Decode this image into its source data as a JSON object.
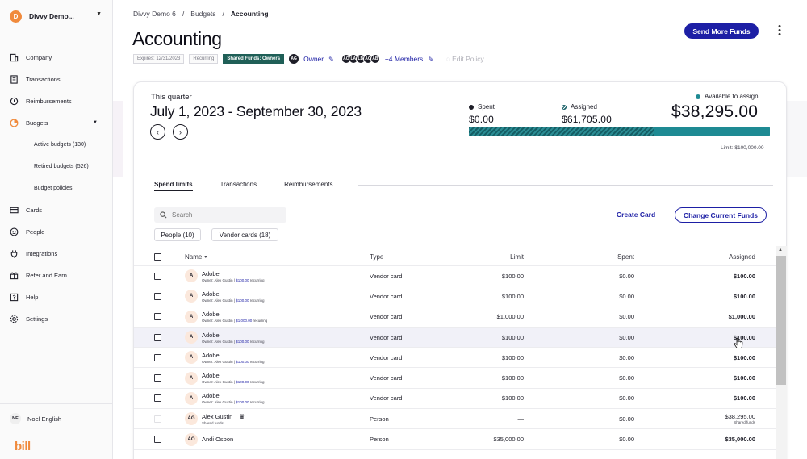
{
  "org": {
    "initial": "D",
    "name": "Divvy Demo..."
  },
  "sidebar": {
    "items": [
      {
        "label": "Company",
        "icon": "building-icon"
      },
      {
        "label": "Transactions",
        "icon": "receipt-icon"
      },
      {
        "label": "Reimbursements",
        "icon": "reimbursement-icon"
      },
      {
        "label": "Budgets",
        "icon": "budget-icon"
      }
    ],
    "budget_sub": [
      "Active budgets (130)",
      "Retired budgets (526)",
      "Budget policies"
    ],
    "items_after": [
      {
        "label": "Cards",
        "icon": "card-icon"
      },
      {
        "label": "People",
        "icon": "people-icon"
      },
      {
        "label": "Integrations",
        "icon": "integrations-icon"
      },
      {
        "label": "Refer and Earn",
        "icon": "gift-icon"
      },
      {
        "label": "Help",
        "icon": "help-icon"
      },
      {
        "label": "Settings",
        "icon": "gear-icon"
      }
    ],
    "user": {
      "initials": "NE",
      "name": "Noel English"
    },
    "logo": "bill"
  },
  "breadcrumb": {
    "first": "Divvy Demo 6",
    "second": "Budgets",
    "current": "Accounting",
    "sep": "/"
  },
  "page": {
    "title": "Accounting",
    "send_funds": "Send More Funds"
  },
  "meta": {
    "expires": "Expires: 12/31/2023",
    "recurring": "Recurring",
    "shared": "Shared Funds: Owners",
    "owner_initials": "AG",
    "owner_label": "Owner",
    "member_initials": [
      "AO",
      "LA",
      "LB",
      "AC",
      "AB"
    ],
    "members_label": "+4 Members",
    "edit_policy": "Edit Policy"
  },
  "summary": {
    "quarter_label": "This quarter",
    "range": "July 1, 2023 - September 30, 2023",
    "spent_label": "Spent",
    "spent_value": "$0.00",
    "assigned_label": "Assigned",
    "assigned_value": "$61,705.00",
    "available_label": "Available to assign",
    "available_value": "$38,295.00",
    "limit": "Limit: $100,000.00",
    "assigned_fraction": 0.617,
    "colors": {
      "spent": "#1d1d27",
      "available": "#1e8a93"
    }
  },
  "tabs": [
    "Spend limits",
    "Transactions",
    "Reimbursements"
  ],
  "toolbar": {
    "search_placeholder": "Search",
    "people_chip": "People (10)",
    "vendor_chip": "Vendor cards (18)",
    "create_card": "Create Card",
    "change_funds": "Change Current Funds"
  },
  "table": {
    "headers": {
      "name": "Name",
      "type": "Type",
      "limit": "Limit",
      "spent": "Spent",
      "assigned": "Assigned"
    },
    "rows": [
      {
        "initials": "A",
        "name": "Adobe",
        "owner": "Owner: Alex Gustin |",
        "amount": "$100.00",
        "rec": "recurring",
        "type": "Vendor card",
        "limit": "$100.00",
        "spent": "$0.00",
        "assigned": "$100.00"
      },
      {
        "initials": "A",
        "name": "Adobe",
        "owner": "Owner: Alex Gustin |",
        "amount": "$100.00",
        "rec": "recurring",
        "type": "Vendor card",
        "limit": "$100.00",
        "spent": "$0.00",
        "assigned": "$100.00"
      },
      {
        "initials": "A",
        "name": "Adobe",
        "owner": "Owner: Alex Gustin |",
        "amount": "$1,000.00",
        "rec": "recurring",
        "type": "Vendor card",
        "limit": "$1,000.00",
        "spent": "$0.00",
        "assigned": "$1,000.00"
      },
      {
        "initials": "A",
        "name": "Adobe",
        "owner": "Owner: Alex Gustin |",
        "amount": "$100.00",
        "rec": "recurring",
        "type": "Vendor card",
        "limit": "$100.00",
        "spent": "$0.00",
        "assigned": "$100.00"
      },
      {
        "initials": "A",
        "name": "Adobe",
        "owner": "Owner: Alex Gustin |",
        "amount": "$100.00",
        "rec": "recurring",
        "type": "Vendor card",
        "limit": "$100.00",
        "spent": "$0.00",
        "assigned": "$100.00"
      },
      {
        "initials": "A",
        "name": "Adobe",
        "owner": "Owner: Alex Gustin |",
        "amount": "$100.00",
        "rec": "recurring",
        "type": "Vendor card",
        "limit": "$100.00",
        "spent": "$0.00",
        "assigned": "$100.00"
      },
      {
        "initials": "A",
        "name": "Adobe",
        "owner": "Owner: Alex Gustin |",
        "amount": "$100.00",
        "rec": "recurring",
        "type": "Vendor card",
        "limit": "$100.00",
        "spent": "$0.00",
        "assigned": "$100.00"
      },
      {
        "initials": "AG",
        "name": "Alex Gustin",
        "sub": "Shared funds",
        "type": "Person",
        "limit": "—",
        "spent": "$0.00",
        "assigned": "$38,295.00",
        "assigned_sub": "Shared funds"
      },
      {
        "initials": "AO",
        "name": "Andi Osbon",
        "type": "Person",
        "limit": "$35,000.00",
        "spent": "$0.00",
        "assigned": "$35,000.00"
      }
    ]
  }
}
